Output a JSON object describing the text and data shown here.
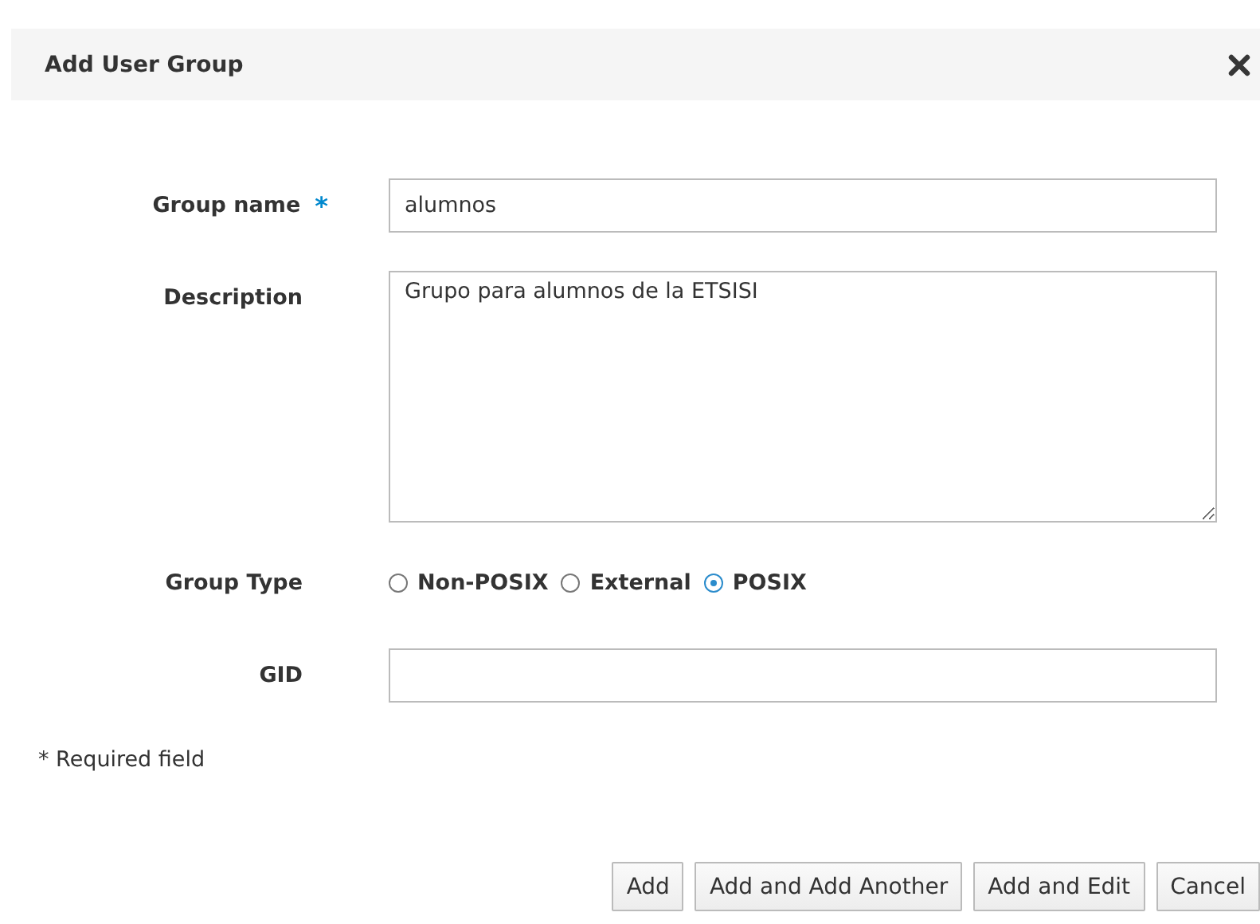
{
  "dialog": {
    "title": "Add User Group"
  },
  "required_mark": "*",
  "fields": [
    {
      "kind": "text",
      "label": "Group name",
      "required": true,
      "value": "alumnos"
    },
    {
      "kind": "textarea",
      "label": "Description",
      "required": false,
      "value": "Grupo para alumnos de la ETSISI"
    },
    {
      "kind": "radio",
      "label": "Group Type",
      "required": false,
      "options": [
        {
          "label": "Non-POSIX",
          "selected": false
        },
        {
          "label": "External",
          "selected": false
        },
        {
          "label": "POSIX",
          "selected": true
        }
      ]
    },
    {
      "kind": "text",
      "label": "GID",
      "required": false
    }
  ],
  "required_note": "* Required field",
  "buttons": [
    "Add",
    "Add and Add Another",
    "Add and Edit",
    "Cancel"
  ]
}
